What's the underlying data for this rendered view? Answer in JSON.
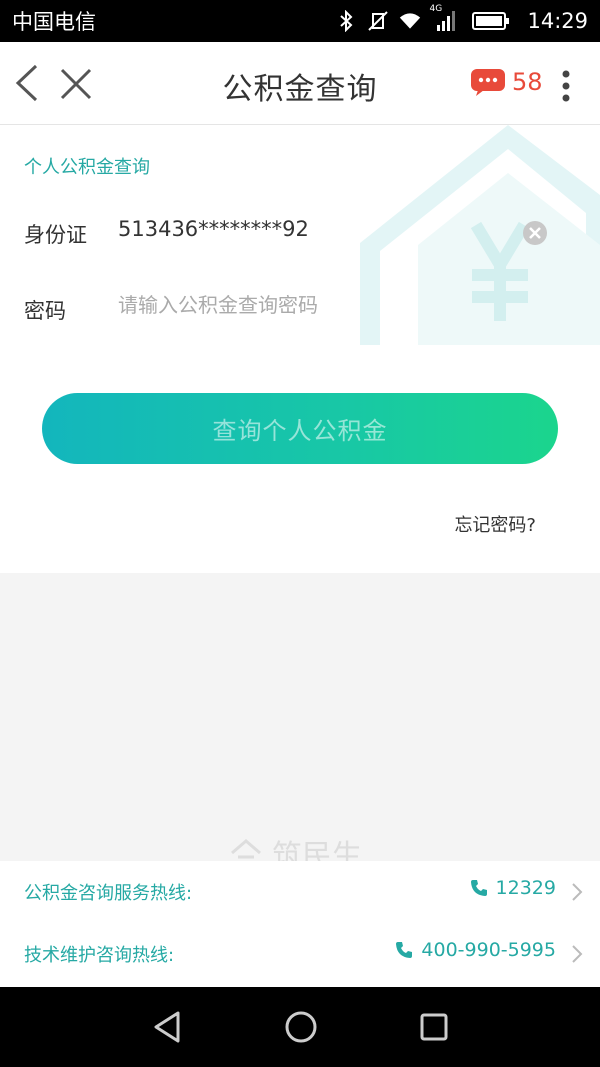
{
  "status_bar": {
    "carrier": "中国电信",
    "network": "4G",
    "time": "14:29"
  },
  "header": {
    "title": "公积金查询",
    "message_count": "58",
    "colors": {
      "badge": "#e84a3a"
    }
  },
  "form": {
    "section_title": "个人公积金查询",
    "id_label": "身份证",
    "id_value": "513436********92",
    "password_label": "密码",
    "password_placeholder": "请输入公积金查询密码",
    "query_button": "查询个人公积金",
    "forgot_password": "忘记密码?"
  },
  "watermark": {
    "text": "筑民生"
  },
  "hotlines": [
    {
      "label": "公积金咨询服务热线:",
      "number": "12329"
    },
    {
      "label": "技术维护咨询热线:",
      "number": "400-990-5995"
    }
  ],
  "theme": {
    "accent": "#26a9a4",
    "button_gradient_start": "#13b6bd",
    "button_gradient_end": "#1bd58d"
  }
}
